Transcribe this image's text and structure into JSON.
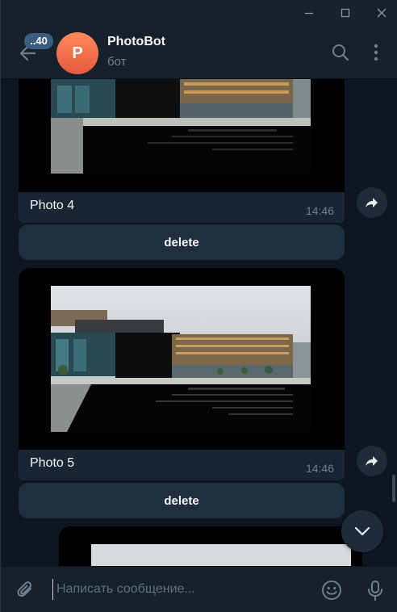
{
  "window": {
    "controls": [
      "minimize-icon",
      "maximize-icon",
      "close-icon"
    ]
  },
  "header": {
    "unread_count": "..40",
    "avatar_letter": "P",
    "title": "PhotoBot",
    "subtitle": "бот",
    "colors": {
      "avatar": "#f06a48",
      "header_bg": "#17212b"
    }
  },
  "messages": [
    {
      "caption": "Photo 4",
      "time": "14:46",
      "action_label": "delete"
    },
    {
      "caption": "Photo 5",
      "time": "14:46",
      "action_label": "delete"
    }
  ],
  "composer": {
    "placeholder": "Написать сообщение...",
    "icons": [
      "paperclip-icon",
      "emoji-icon",
      "microphone-icon"
    ]
  },
  "colors": {
    "background": "#0e1621",
    "bubble": "#182533",
    "button": "#1f2f3f",
    "accent_text": "#6d7f8f"
  }
}
